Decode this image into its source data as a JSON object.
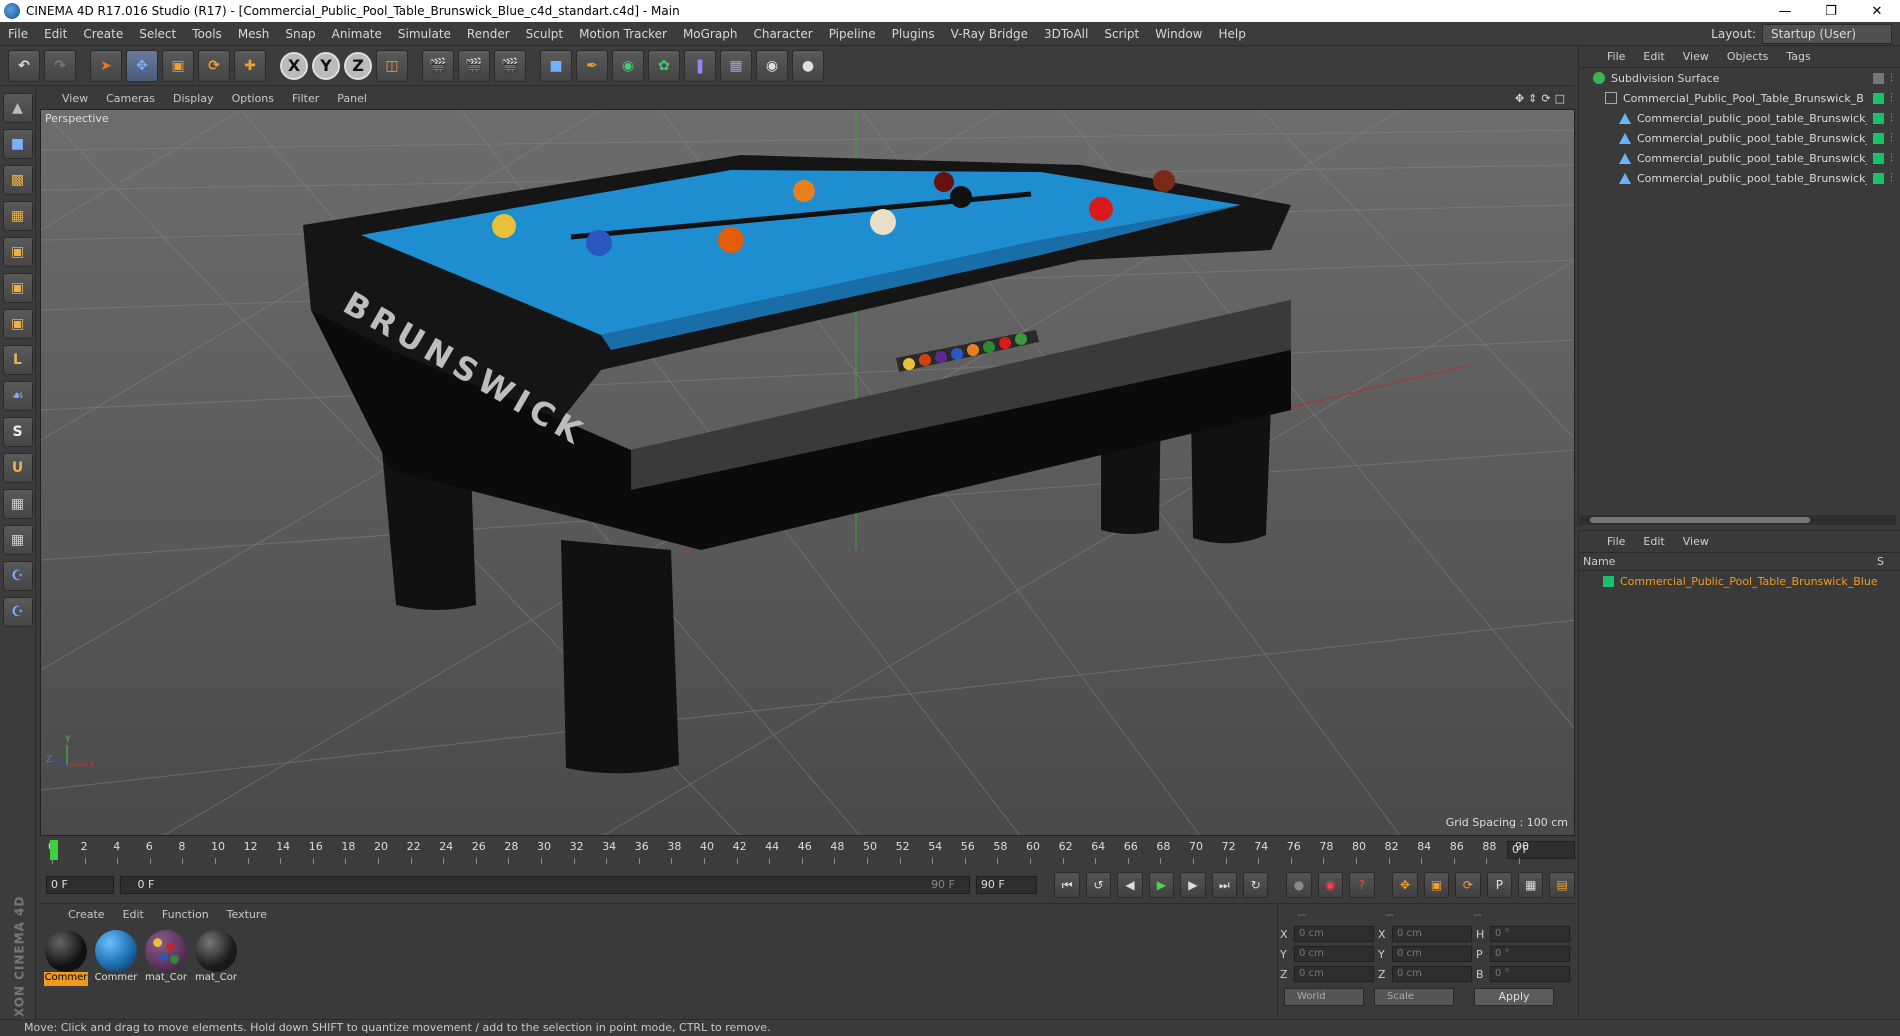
{
  "window": {
    "title": "CINEMA 4D R17.016 Studio (R17) - [Commercial_Public_Pool_Table_Brunswick_Blue_c4d_standart.c4d] - Main"
  },
  "menubar": {
    "items": [
      "File",
      "Edit",
      "Create",
      "Select",
      "Tools",
      "Mesh",
      "Snap",
      "Animate",
      "Simulate",
      "Render",
      "Sculpt",
      "Motion Tracker",
      "MoGraph",
      "Character",
      "Pipeline",
      "Plugins",
      "V-Ray Bridge",
      "3DToAll",
      "Script",
      "Window",
      "Help"
    ],
    "layout_label": "Layout:",
    "layout_value": "Startup (User)"
  },
  "toolbar": {
    "axis_x": "X",
    "axis_y": "Y",
    "axis_z": "Z"
  },
  "viewport": {
    "menu": [
      "View",
      "Cameras",
      "Display",
      "Options",
      "Filter",
      "Panel"
    ],
    "label": "Perspective",
    "grid_spacing": "Grid Spacing : 100 cm",
    "table_text": "BRUNSWICK"
  },
  "timeline": {
    "ticks": [
      "0",
      "2",
      "4",
      "6",
      "8",
      "10",
      "12",
      "14",
      "16",
      "18",
      "20",
      "22",
      "24",
      "26",
      "28",
      "30",
      "32",
      "34",
      "36",
      "38",
      "40",
      "42",
      "44",
      "46",
      "48",
      "50",
      "52",
      "54",
      "56",
      "58",
      "60",
      "62",
      "64",
      "66",
      "68",
      "70",
      "72",
      "74",
      "76",
      "78",
      "80",
      "82",
      "84",
      "86",
      "88",
      "90"
    ],
    "end_field": "0 F",
    "start_frame": "0 F",
    "range_start": "0 F",
    "range_end": "90 F",
    "max_frame": "90 F"
  },
  "material_manager": {
    "menu": [
      "Create",
      "Edit",
      "Function",
      "Texture"
    ],
    "materials": [
      {
        "label": "Commer",
        "selected": true,
        "color": "#111111"
      },
      {
        "label": "Commer",
        "selected": false,
        "color": "#1e6fb0"
      },
      {
        "label": "mat_Cor",
        "selected": false,
        "color": "#7a3a7a"
      },
      {
        "label": "mat_Cor",
        "selected": false,
        "color": "#222222"
      }
    ]
  },
  "coordinates": {
    "header_a": "--",
    "header_b": "--",
    "header_c": "--",
    "rows": [
      {
        "a": "X",
        "av": "0 cm",
        "b": "X",
        "bv": "0 cm",
        "c": "H",
        "cv": "0 °"
      },
      {
        "a": "Y",
        "av": "0 cm",
        "b": "Y",
        "bv": "0 cm",
        "c": "P",
        "cv": "0 °"
      },
      {
        "a": "Z",
        "av": "0 cm",
        "b": "Z",
        "bv": "0 cm",
        "c": "B",
        "cv": "0 °"
      }
    ],
    "world": "World",
    "scale": "Scale",
    "apply": "Apply"
  },
  "object_manager": {
    "menu": [
      "File",
      "Edit",
      "View",
      "Objects",
      "Tags"
    ],
    "objects": [
      {
        "name": "Subdivision Surface",
        "indent": 0,
        "icon": "sub"
      },
      {
        "name": "Commercial_Public_Pool_Table_Brunswick_Blu",
        "indent": 1,
        "icon": "null"
      },
      {
        "name": "Commercial_public_pool_table_Brunswick_C",
        "indent": 2,
        "icon": "poly"
      },
      {
        "name": "Commercial_public_pool_table_Brunswick_b",
        "indent": 2,
        "icon": "poly"
      },
      {
        "name": "Commercial_public_pool_table_Brunswick_L",
        "indent": 2,
        "icon": "poly"
      },
      {
        "name": "Commercial_public_pool_table_Brunswick_T",
        "indent": 2,
        "icon": "poly"
      }
    ]
  },
  "attribute_manager": {
    "menu": [
      "File",
      "Edit",
      "View"
    ],
    "col_name": "Name",
    "col_s": "S",
    "layer": "Commercial_Public_Pool_Table_Brunswick_Blue"
  },
  "status": "Move: Click and drag to move elements. Hold down SHIFT to quantize movement / add to the selection in point mode, CTRL to remove.",
  "brand": "MAXON CINEMA 4D",
  "colors": {
    "accent_orange": "#f09b1f",
    "tag_green": "#18c26a",
    "felt_blue": "#1e8ed0"
  }
}
